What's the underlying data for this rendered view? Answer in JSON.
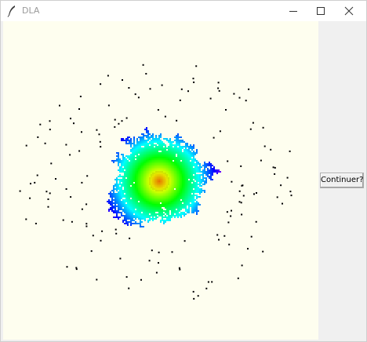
{
  "window": {
    "title": "DLA",
    "app_icon": "feather-icon",
    "controls": {
      "minimize_icon": "minimize-icon",
      "maximize_icon": "maximize-icon",
      "close_icon": "close-icon"
    }
  },
  "canvas": {
    "background": "#fefeef",
    "simulation": "dla-cluster"
  },
  "sidebar": {
    "continue_label": "Continuer?"
  }
}
